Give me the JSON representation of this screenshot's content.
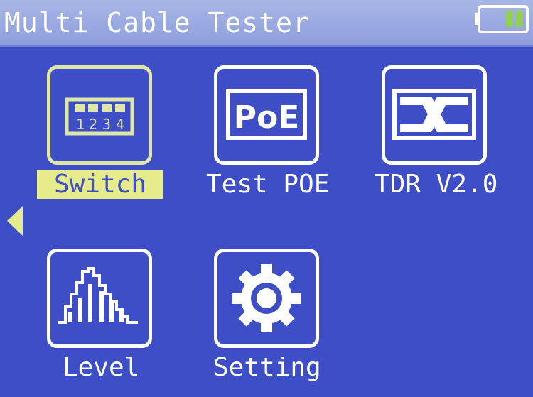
{
  "header": {
    "title": "Multi Cable Tester",
    "battery_icon": "battery-icon",
    "battery_level": 0.4
  },
  "menu": {
    "items": [
      {
        "label": "Switch",
        "icon": "dip-switch-icon",
        "selected": true
      },
      {
        "label": "Test POE",
        "icon": "poe-icon",
        "selected": false
      },
      {
        "label": "TDR V2.0",
        "icon": "tdr-icon",
        "selected": false
      },
      {
        "label": "Level",
        "icon": "level-icon",
        "selected": false
      },
      {
        "label": "Setting",
        "icon": "gear-icon",
        "selected": false
      }
    ],
    "poe_text": "PoE",
    "switch_digits": [
      "1",
      "2",
      "3",
      "4"
    ]
  },
  "nav": {
    "left_arrow_icon": "left-arrow-icon"
  },
  "colors": {
    "background": "#3d4ec6",
    "title_bar": "#a0b0e3",
    "selection_highlight": "#e6ec8c",
    "battery_fill": "#92d050"
  }
}
